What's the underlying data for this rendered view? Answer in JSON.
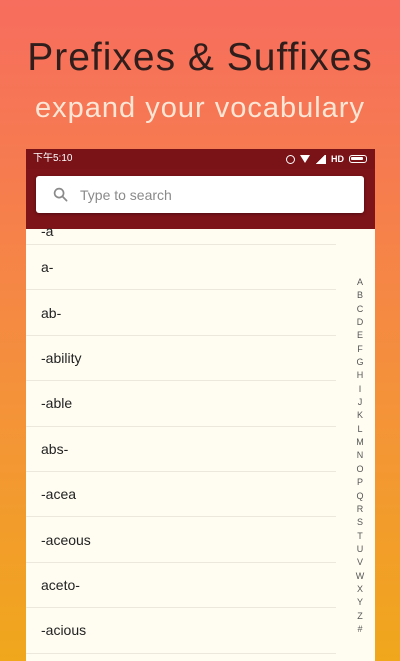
{
  "promo": {
    "title": "Prefixes & Suffixes",
    "subtitle": "expand your vocabulary"
  },
  "status_bar": {
    "time": "下午5:10",
    "network": "HD"
  },
  "search": {
    "placeholder": "Type to search",
    "icon": "search-icon"
  },
  "list": {
    "items": [
      "-a",
      "a-",
      "ab-",
      "-ability",
      "-able",
      "abs-",
      "-acea",
      "-aceous",
      "aceto-",
      "-acious"
    ]
  },
  "index": {
    "letters": [
      "A",
      "B",
      "C",
      "D",
      "E",
      "F",
      "G",
      "H",
      "I",
      "J",
      "K",
      "L",
      "M",
      "N",
      "O",
      "P",
      "Q",
      "R",
      "S",
      "T",
      "U",
      "V",
      "W",
      "X",
      "Y",
      "Z",
      "#"
    ]
  },
  "colors": {
    "appbar": "#7c1419",
    "statusbar": "#7a1318",
    "list_background": "#fffdf1",
    "gradient_top": "#f76d5e",
    "gradient_bottom": "#f0a71c"
  }
}
